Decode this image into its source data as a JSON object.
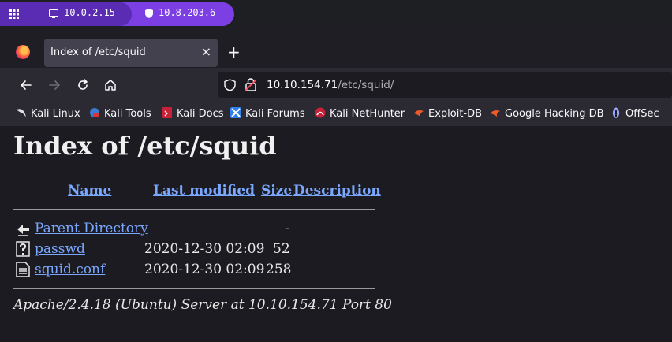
{
  "panel": {
    "tabs": [
      {
        "label": "10.0.2.15",
        "icon": "monitor-icon"
      },
      {
        "label": "10.8.203.6",
        "icon": "shield-icon"
      }
    ],
    "menu_icon": "grid-menu-icon",
    "accent": "#7b3fe4"
  },
  "browser": {
    "tab_title": "Index of /etc/squid",
    "new_tab": "+",
    "close": "×",
    "url_host": "10.10.154.71",
    "url_path": "/etc/squid/",
    "bookmarks": [
      {
        "label": "Kali Linux",
        "icon": "kali-dragon-icon"
      },
      {
        "label": "Kali Tools",
        "icon": "kali-tools-icon"
      },
      {
        "label": "Kali Docs",
        "icon": "kali-docs-icon"
      },
      {
        "label": "Kali Forums",
        "icon": "kali-forums-icon"
      },
      {
        "label": "Kali NetHunter",
        "icon": "nethunter-icon"
      },
      {
        "label": "Exploit-DB",
        "icon": "exploit-db-icon"
      },
      {
        "label": "Google Hacking DB",
        "icon": "ghdb-icon"
      },
      {
        "label": "OffSec",
        "icon": "offsec-icon"
      }
    ]
  },
  "page": {
    "title": "Index of /etc/squid",
    "columns": {
      "name": "Name",
      "last_modified": "Last modified",
      "size": "Size",
      "description": "Description"
    },
    "rows": [
      {
        "name": "Parent Directory",
        "modified": "",
        "size": "-",
        "icon": "back-arrow-icon"
      },
      {
        "name": "passwd",
        "modified": "2020-12-30 02:09",
        "size": "52",
        "icon": "unknown-file-icon"
      },
      {
        "name": "squid.conf",
        "modified": "2020-12-30 02:09",
        "size": "258",
        "icon": "text-file-icon"
      }
    ],
    "address": "Apache/2.4.18 (Ubuntu) Server at 10.10.154.71 Port 80"
  }
}
